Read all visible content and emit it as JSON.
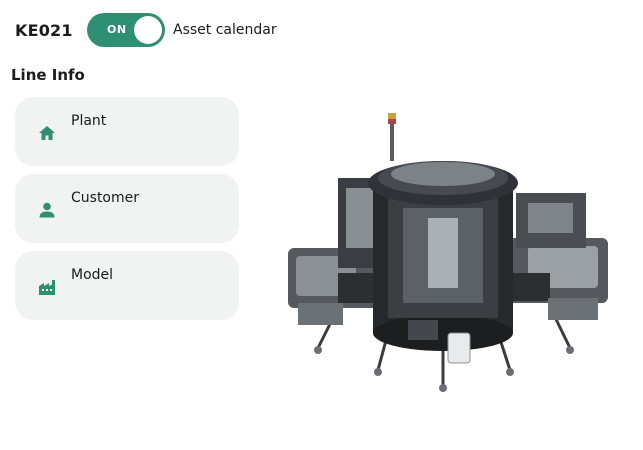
{
  "header": {
    "asset_id": "KE021",
    "toggle_state": "ON",
    "toggle_label": "Asset calendar"
  },
  "section": {
    "title": "Line Info"
  },
  "cards": [
    {
      "label": "Plant",
      "icon": "home-icon"
    },
    {
      "label": "Customer",
      "icon": "person-icon"
    },
    {
      "label": "Model",
      "icon": "factory-icon"
    }
  ],
  "colors": {
    "accent": "#2f8f73",
    "card_bg": "#f0f3f1"
  },
  "image": {
    "icon": "machine-image"
  }
}
